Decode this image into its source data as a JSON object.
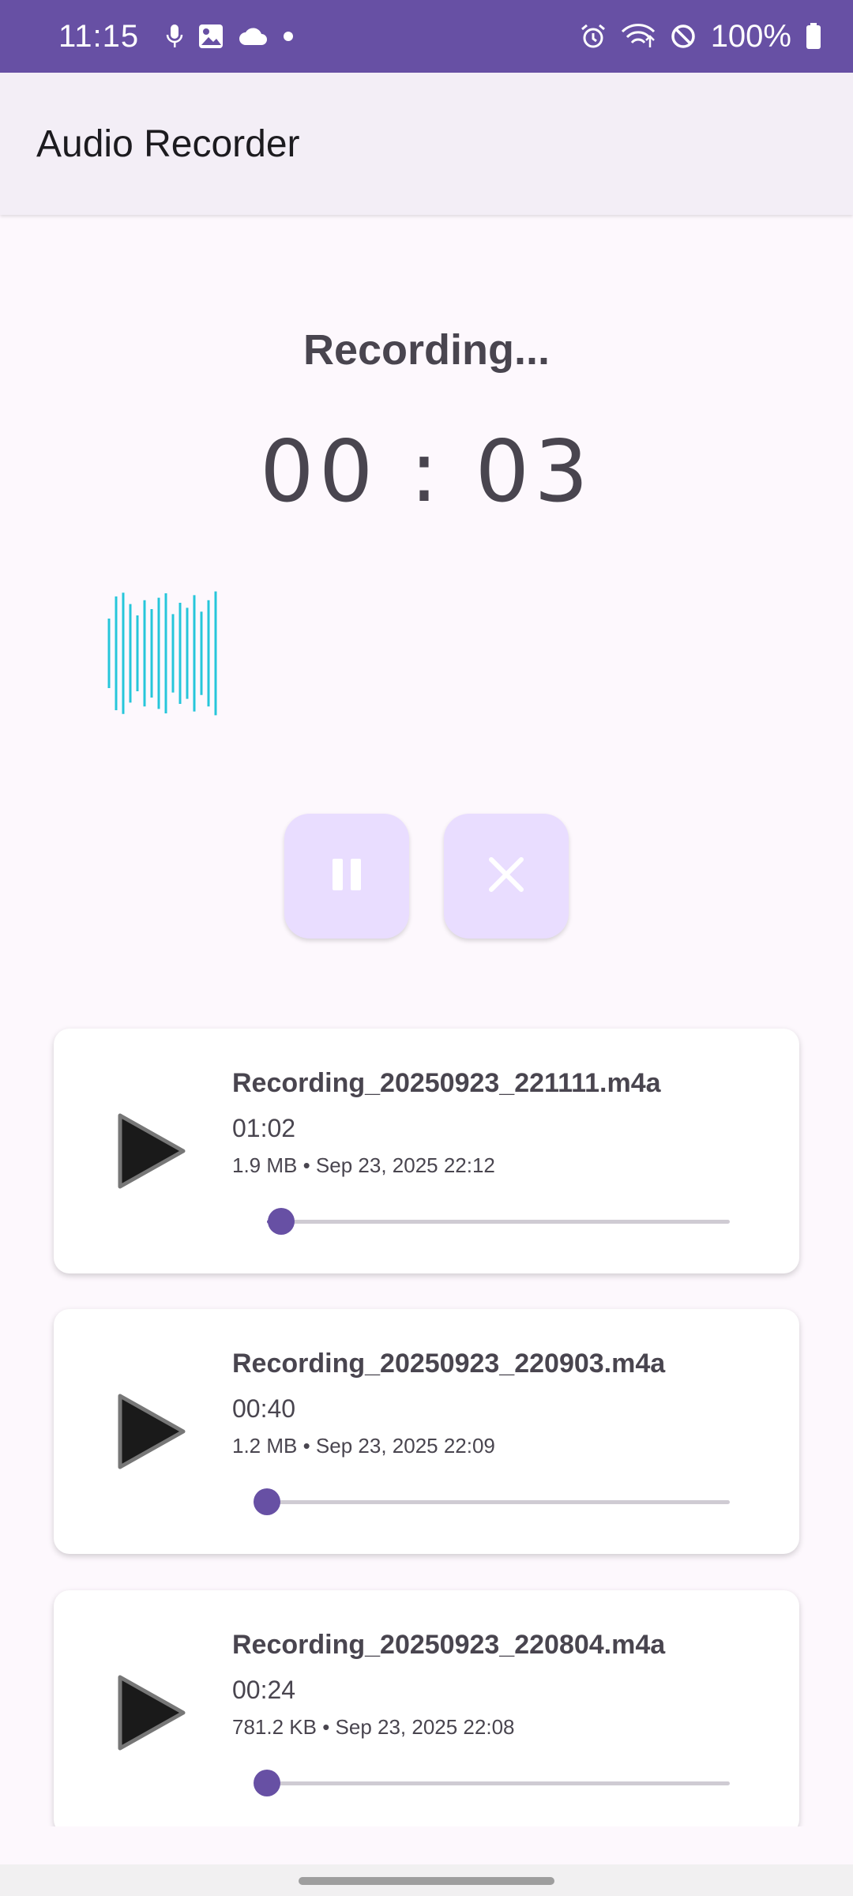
{
  "status_bar": {
    "time": "11:15",
    "battery": "100%",
    "icons_left": [
      "mic-icon",
      "image-icon",
      "cloud-icon",
      "dot-icon"
    ],
    "icons_right": [
      "alarm-icon",
      "wifi-icon",
      "do-not-disturb-icon",
      "battery-icon"
    ]
  },
  "app_bar": {
    "title": "Audio Recorder"
  },
  "recorder": {
    "status": "Recording...",
    "timer": "00 : 03",
    "pause_icon": "pause-icon",
    "cancel_icon": "close-icon",
    "waveform_color": "#26c6da"
  },
  "recordings": [
    {
      "name": "Recording_20250923_221111.m4a",
      "duration": "01:02",
      "meta": "1.9 MB • Sep 23, 2025 22:12",
      "progress": 0.03
    },
    {
      "name": "Recording_20250923_220903.m4a",
      "duration": "00:40",
      "meta": "1.2 MB • Sep 23, 2025 22:09",
      "progress": 0.0
    },
    {
      "name": "Recording_20250923_220804.m4a",
      "duration": "00:24",
      "meta": "781.2 KB • Sep 23, 2025 22:08",
      "progress": 0.0
    }
  ],
  "colors": {
    "accent": "#6750a4",
    "button_bg": "#e9ddff",
    "background": "#fdf8fd"
  }
}
